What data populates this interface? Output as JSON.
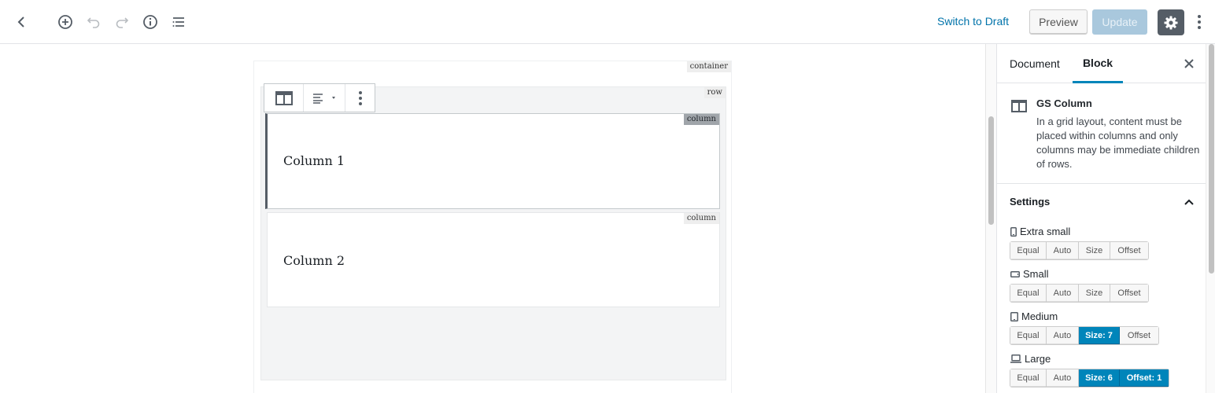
{
  "topbar": {
    "icons": [
      "back-arrow-icon",
      "add-block-icon",
      "undo-icon",
      "redo-icon",
      "info-icon",
      "block-navigation-icon",
      "gear-icon",
      "more-vertical-icon"
    ],
    "switch_draft": "Switch to Draft",
    "preview": "Preview",
    "update": "Update"
  },
  "editor": {
    "container_tag": "container",
    "row_tag": "row",
    "columns": [
      {
        "tag": "column",
        "text": "Column 1"
      },
      {
        "tag": "column",
        "text": "Column 2"
      }
    ],
    "toolbar_icons": [
      "columns-icon",
      "align-icon",
      "more-vertical-icon"
    ]
  },
  "sidebar": {
    "tabs": [
      "Document",
      "Block"
    ],
    "active_tab": "Block",
    "block": {
      "title": "GS Column",
      "description": "In a grid layout, content must be placed within columns and only columns may be immediate children of rows."
    },
    "settings_title": "Settings",
    "breakpoints": [
      {
        "label": "Extra small",
        "icon": "phone-icon",
        "buttons": [
          "Equal",
          "Auto",
          "Size",
          "Offset"
        ],
        "active": []
      },
      {
        "label": "Small",
        "icon": "phone-landscape-icon",
        "buttons": [
          "Equal",
          "Auto",
          "Size",
          "Offset"
        ],
        "active": []
      },
      {
        "label": "Medium",
        "icon": "tablet-icon",
        "buttons": [
          "Equal",
          "Auto",
          "Size: 7",
          "Offset"
        ],
        "active": [
          2
        ]
      },
      {
        "label": "Large",
        "icon": "laptop-icon",
        "buttons": [
          "Equal",
          "Auto",
          "Size: 6",
          "Offset: 1"
        ],
        "active": [
          2,
          3
        ]
      }
    ],
    "accent": "#0085ba"
  }
}
